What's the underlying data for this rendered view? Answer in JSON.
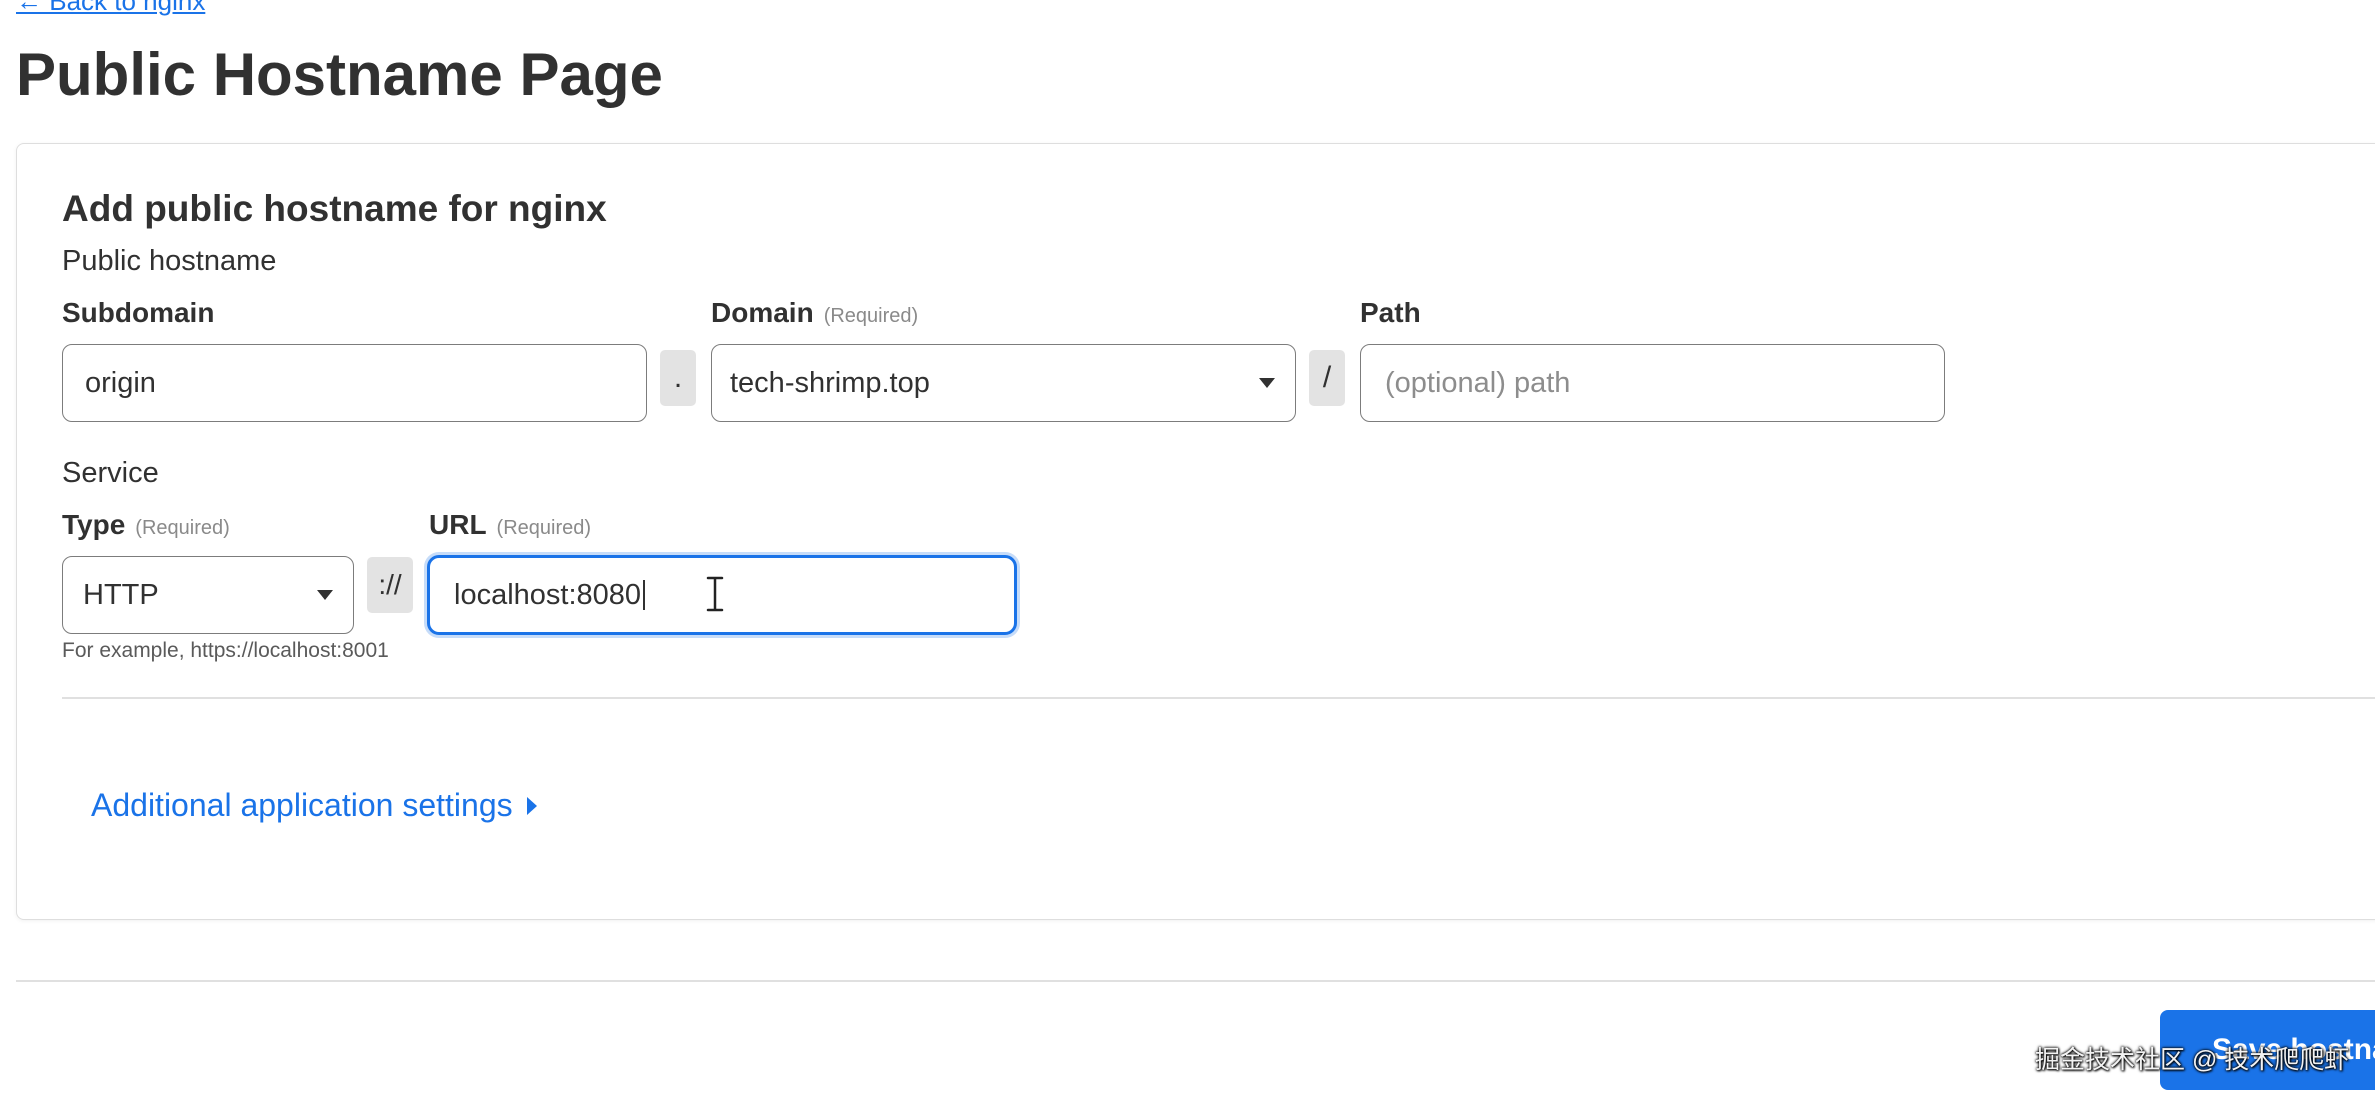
{
  "nav": {
    "back_link": "← Back to nginx"
  },
  "page": {
    "title": "Public Hostname Page"
  },
  "form": {
    "title": "Add public hostname for nginx",
    "public_hostname": {
      "section_label": "Public hostname",
      "subdomain": {
        "label": "Subdomain",
        "value": "origin"
      },
      "dot_separator": ".",
      "domain": {
        "label": "Domain",
        "required": "(Required)",
        "value": "tech-shrimp.top"
      },
      "slash_separator": "/",
      "path": {
        "label": "Path",
        "placeholder": "(optional) path"
      }
    },
    "service": {
      "section_label": "Service",
      "type": {
        "label": "Type",
        "required": "(Required)",
        "value": "HTTP"
      },
      "scheme_separator": "://",
      "url": {
        "label": "URL",
        "required": "(Required)",
        "value": "localhost:8080"
      },
      "help_text": "For example, https://localhost:8001"
    },
    "additional_settings": {
      "label": "Additional application settings"
    }
  },
  "footer": {
    "save_button": "Save hostname"
  },
  "watermark": {
    "text": "掘金技术社区 @ 技术爬爬虾"
  },
  "colors": {
    "accent": "#1a73e8",
    "text": "#313131",
    "border": "#7c7c7c"
  },
  "icons": {
    "domain_dropdown": "chevron-down-icon",
    "type_dropdown": "chevron-down-icon",
    "additional_settings": "caret-right-icon",
    "mouse_cursor": "text-cursor-icon"
  }
}
